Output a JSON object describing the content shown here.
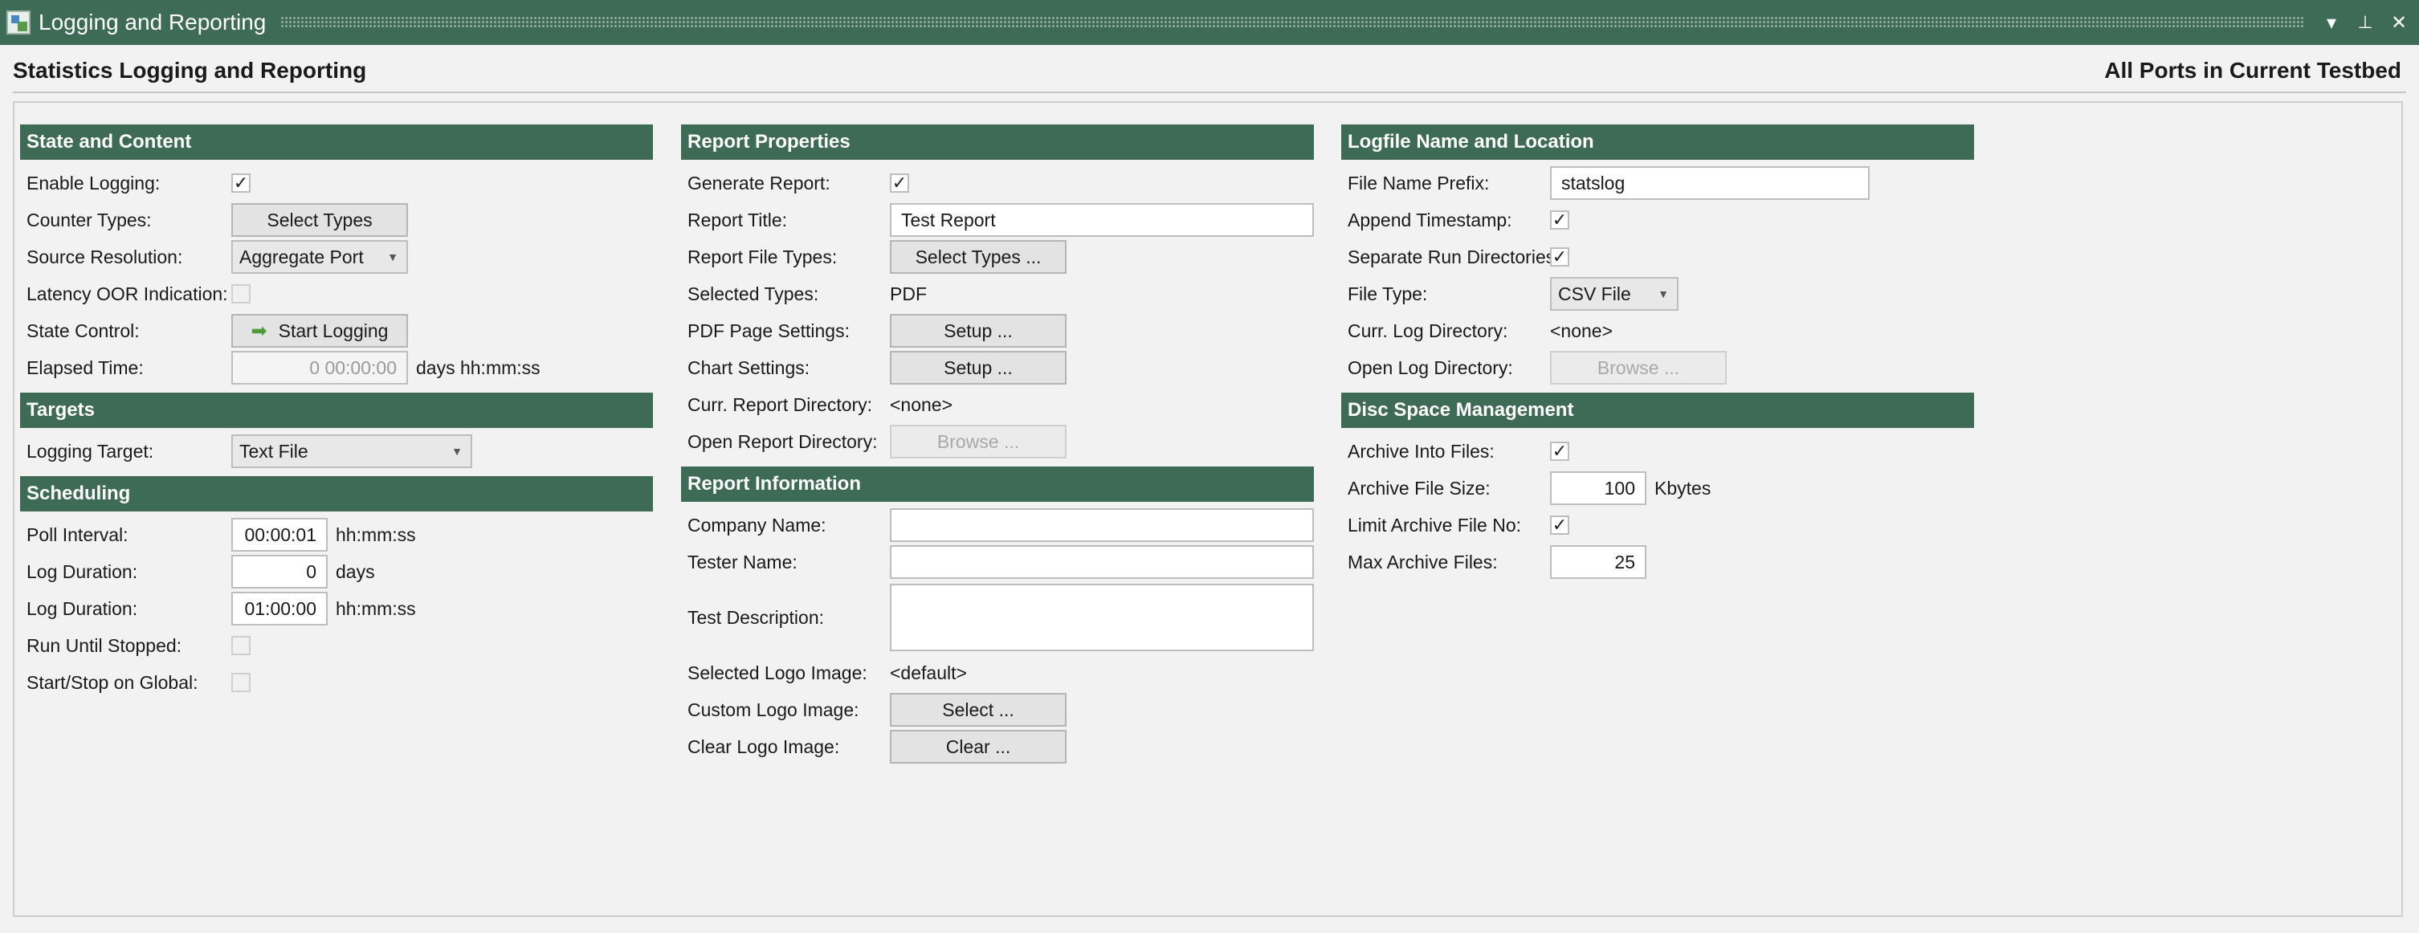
{
  "window": {
    "title": "Logging and Reporting"
  },
  "header": {
    "title": "Statistics Logging and Reporting",
    "scope": "All Ports in Current Testbed"
  },
  "state_content": {
    "title": "State and Content",
    "enable_logging": {
      "label": "Enable Logging:",
      "checked": true
    },
    "counter_types": {
      "label": "Counter Types:",
      "button": "Select Types"
    },
    "source_resolution": {
      "label": "Source Resolution:",
      "value": "Aggregate Port"
    },
    "latency_oor": {
      "label": "Latency OOR Indication:",
      "checked": false
    },
    "state_control": {
      "label": "State Control:",
      "button": "Start Logging"
    },
    "elapsed_time": {
      "label": "Elapsed Time:",
      "value": "0 00:00:00",
      "unit": "days hh:mm:ss"
    }
  },
  "targets": {
    "title": "Targets",
    "logging_target": {
      "label": "Logging Target:",
      "value": "Text File"
    }
  },
  "scheduling": {
    "title": "Scheduling",
    "poll_interval": {
      "label": "Poll Interval:",
      "value": "00:00:01",
      "unit": "hh:mm:ss"
    },
    "log_duration_days": {
      "label": "Log Duration:",
      "value": "0",
      "unit": "days"
    },
    "log_duration_time": {
      "label": "Log Duration:",
      "value": "01:00:00",
      "unit": "hh:mm:ss"
    },
    "run_until_stopped": {
      "label": "Run Until Stopped:",
      "checked": false
    },
    "start_stop_global": {
      "label": "Start/Stop on Global:",
      "checked": false
    }
  },
  "report_properties": {
    "title": "Report Properties",
    "generate_report": {
      "label": "Generate Report:",
      "checked": true
    },
    "report_title": {
      "label": "Report Title:",
      "value": "Test Report"
    },
    "report_file_types": {
      "label": "Report File Types:",
      "button": "Select Types ..."
    },
    "selected_types": {
      "label": "Selected Types:",
      "value": "PDF"
    },
    "pdf_page_settings": {
      "label": "PDF Page Settings:",
      "button": "Setup ..."
    },
    "chart_settings": {
      "label": "Chart Settings:",
      "button": "Setup ..."
    },
    "curr_report_dir": {
      "label": "Curr. Report Directory:",
      "value": "<none>"
    },
    "open_report_dir": {
      "label": "Open Report Directory:",
      "button": "Browse ..."
    }
  },
  "report_information": {
    "title": "Report Information",
    "company_name": {
      "label": "Company Name:",
      "value": ""
    },
    "tester_name": {
      "label": "Tester Name:",
      "value": ""
    },
    "test_description": {
      "label": "Test Description:",
      "value": ""
    },
    "selected_logo": {
      "label": "Selected Logo Image:",
      "value": "<default>"
    },
    "custom_logo": {
      "label": "Custom Logo Image:",
      "button": "Select ..."
    },
    "clear_logo": {
      "label": "Clear Logo Image:",
      "button": "Clear ..."
    }
  },
  "logfile": {
    "title": "Logfile Name and Location",
    "file_name_prefix": {
      "label": "File Name Prefix:",
      "value": "statslog"
    },
    "append_timestamp": {
      "label": "Append Timestamp:",
      "checked": true
    },
    "separate_run_dirs": {
      "label": "Separate Run Directories:",
      "checked": true
    },
    "file_type": {
      "label": "File Type:",
      "value": "CSV File"
    },
    "curr_log_dir": {
      "label": "Curr. Log Directory:",
      "value": "<none>"
    },
    "open_log_dir": {
      "label": "Open Log Directory:",
      "button": "Browse ..."
    }
  },
  "disc_space": {
    "title": "Disc Space Management",
    "archive_into_files": {
      "label": "Archive Into Files:",
      "checked": true
    },
    "archive_file_size": {
      "label": "Archive File Size:",
      "value": "100",
      "unit": "Kbytes"
    },
    "limit_archive_file_no": {
      "label": "Limit Archive File No:",
      "checked": true
    },
    "max_archive_files": {
      "label": "Max Archive Files:",
      "value": "25"
    }
  },
  "icons": {
    "check": "✓",
    "caret": "▼",
    "arrow": "➡",
    "dropdown": "▾",
    "pin": "📌",
    "close": "✕"
  },
  "colors": {
    "header_bg": "#3d6b56",
    "accent_green": "#4c9a3a"
  }
}
